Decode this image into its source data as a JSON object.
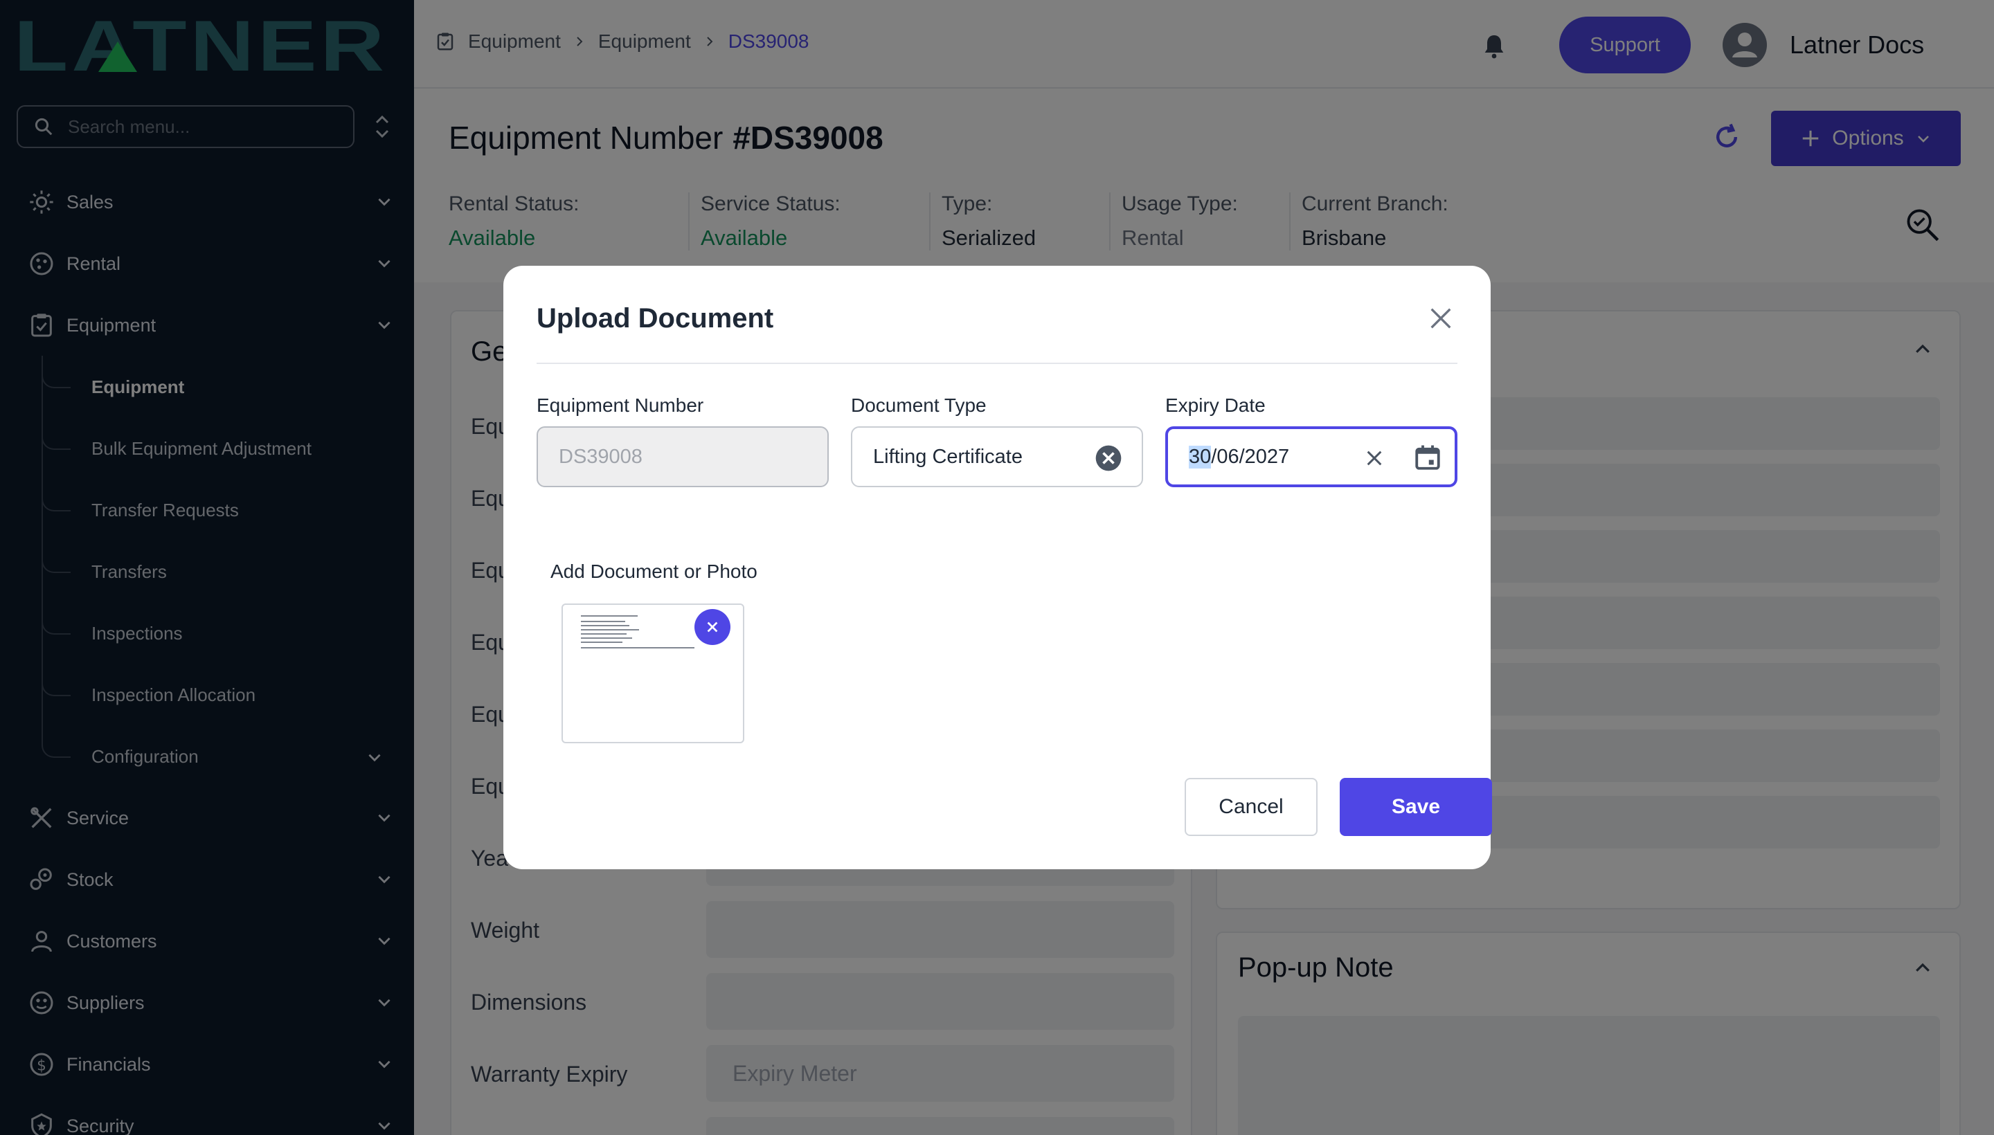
{
  "app": {
    "logo_text": "LATNER",
    "search_placeholder": "Search menu..."
  },
  "sidebar": {
    "items": [
      {
        "label": "Sales",
        "icon": "sales-icon"
      },
      {
        "label": "Rental",
        "icon": "rental-icon"
      },
      {
        "label": "Equipment",
        "icon": "equipment-icon"
      },
      {
        "label": "Service",
        "icon": "service-icon"
      },
      {
        "label": "Stock",
        "icon": "stock-icon"
      },
      {
        "label": "Customers",
        "icon": "customers-icon"
      },
      {
        "label": "Suppliers",
        "icon": "suppliers-icon"
      },
      {
        "label": "Financials",
        "icon": "financials-icon"
      },
      {
        "label": "Security",
        "icon": "security-icon"
      }
    ],
    "equipment_sub": [
      {
        "label": "Equipment",
        "active": true
      },
      {
        "label": "Bulk Equipment Adjustment"
      },
      {
        "label": "Transfer Requests"
      },
      {
        "label": "Transfers"
      },
      {
        "label": "Inspections"
      },
      {
        "label": "Inspection Allocation"
      },
      {
        "label": "Configuration"
      }
    ]
  },
  "header": {
    "breadcrumbs": [
      "Equipment",
      "Equipment",
      "DS39008"
    ],
    "support_label": "Support",
    "user_name": "Latner Docs"
  },
  "page": {
    "title_prefix": "Equipment Number",
    "title_number": "#DS39008",
    "options_label": "Options",
    "statuses": [
      {
        "label": "Rental Status:",
        "value": "Available"
      },
      {
        "label": "Service Status:",
        "value": "Available"
      },
      {
        "label": "Type:",
        "value": "Serialized"
      },
      {
        "label": "Usage Type:",
        "value": "Rental"
      },
      {
        "label": "Current Branch:",
        "value": "Brisbane"
      }
    ],
    "general_card_title_fragment": "Ge",
    "general_fields": [
      "Equ",
      "Equ",
      "Equ",
      "Equ",
      "Equ",
      "Equ",
      "Yea",
      "Weight",
      "Dimensions",
      "Warranty Expiry"
    ],
    "warranty_placeholder": "Expiry Meter",
    "popup_note_title": "Pop-up Note"
  },
  "modal": {
    "title": "Upload Document",
    "fields": {
      "equipment_number": {
        "label": "Equipment Number",
        "value": "DS39008"
      },
      "document_type": {
        "label": "Document Type",
        "value": "Lifting Certificate"
      },
      "expiry_date": {
        "label": "Expiry Date",
        "value_selected": "30",
        "value_rest": "/06/2027"
      }
    },
    "add_document_label": "Add Document or Photo",
    "cancel_label": "Cancel",
    "save_label": "Save"
  },
  "colors": {
    "accent": "#4f46e5",
    "sidebar_bg": "#0d1a2b",
    "status_green": "#15935c",
    "logo_teal": "#2c6b73"
  }
}
